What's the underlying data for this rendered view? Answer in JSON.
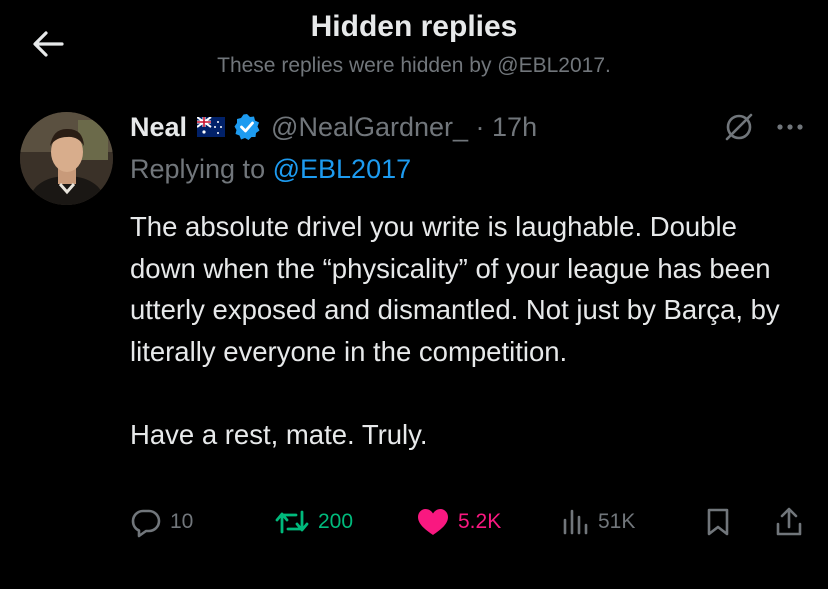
{
  "header": {
    "title": "Hidden replies",
    "subtitle": "These replies were hidden by @EBL2017."
  },
  "tweet": {
    "name": "Neal",
    "flag": "australia-flag",
    "handle_time": "@NealGardner_ · 17h",
    "replying_prefix": "Replying to",
    "replying_mention": "@EBL2017",
    "paragraphs": [
      "The absolute drivel you write is laughable. Double down when the “physicality” of your league has been utterly exposed and dismantled. Not just by Barça, by literally everyone in the competition.",
      "Have a rest, mate. Truly."
    ]
  },
  "actions": {
    "reply_count": "10",
    "retweet_count": "200",
    "like_count": "5.2K",
    "views_count": "51K"
  },
  "colors": {
    "background": "#000000",
    "text": "#e7e9ea",
    "muted": "#71767b",
    "accent": "#1d9bf0",
    "retweet": "#00ba7c",
    "like": "#f91880"
  }
}
